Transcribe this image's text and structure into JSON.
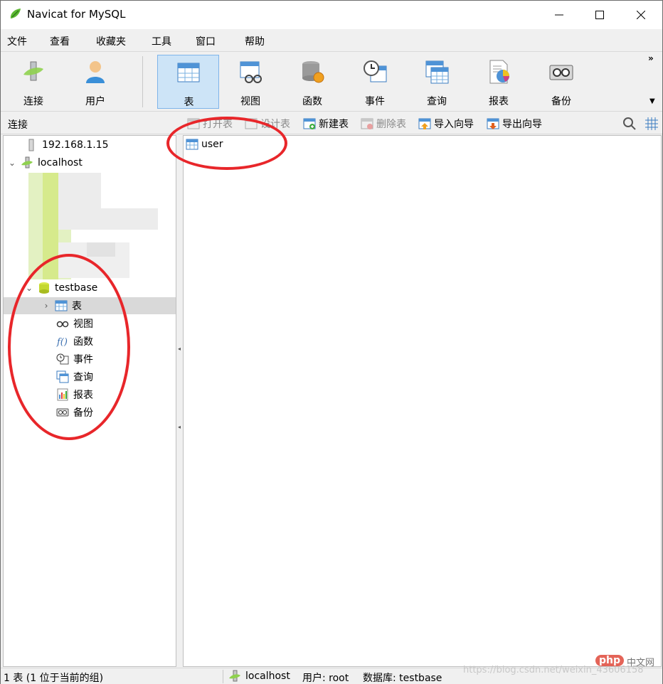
{
  "window": {
    "title": "Navicat for MySQL"
  },
  "menu": [
    "文件",
    "查看",
    "收藏夹",
    "工具",
    "窗口",
    "帮助"
  ],
  "toolbar": {
    "buttons": [
      {
        "label": "连接",
        "icon": "connection-icon"
      },
      {
        "label": "用户",
        "icon": "user-icon"
      },
      {
        "label": "表",
        "icon": "table-icon",
        "active": true
      },
      {
        "label": "视图",
        "icon": "view-icon"
      },
      {
        "label": "函数",
        "icon": "function-icon"
      },
      {
        "label": "事件",
        "icon": "event-icon"
      },
      {
        "label": "查询",
        "icon": "query-icon"
      },
      {
        "label": "报表",
        "icon": "report-icon"
      },
      {
        "label": "备份",
        "icon": "backup-icon"
      }
    ],
    "more": "»"
  },
  "subbar": {
    "connection_label": "连接",
    "actions": [
      {
        "label": "打开表",
        "enabled": false
      },
      {
        "label": "设计表",
        "enabled": false
      },
      {
        "label": "新建表",
        "enabled": true
      },
      {
        "label": "删除表",
        "enabled": false
      },
      {
        "label": "导入向导",
        "enabled": true
      },
      {
        "label": "导出向导",
        "enabled": true
      }
    ]
  },
  "tree": {
    "connections": [
      {
        "name": "192.168.1.15"
      },
      {
        "name": "localhost"
      }
    ],
    "database": "testbase",
    "objects": [
      {
        "label": "表",
        "icon": "table-icon",
        "selected": true
      },
      {
        "label": "视图",
        "icon": "view-icon"
      },
      {
        "label": "函数",
        "icon": "function-icon"
      },
      {
        "label": "事件",
        "icon": "event-icon"
      },
      {
        "label": "查询",
        "icon": "query-icon"
      },
      {
        "label": "报表",
        "icon": "report-icon"
      },
      {
        "label": "备份",
        "icon": "backup-icon"
      }
    ]
  },
  "objects_pane": {
    "items": [
      "user"
    ]
  },
  "status": {
    "left": "1 表 (1 位于当前的组)",
    "connection": "localhost",
    "user": "用户: root",
    "database": "数据库: testbase"
  },
  "watermark": {
    "logo": "php",
    "cn": "中文网",
    "url": "https://blog.csdn.net/weixin_43606158"
  },
  "colors": {
    "accent": "#cde4f7",
    "annotation": "#e8262a"
  }
}
